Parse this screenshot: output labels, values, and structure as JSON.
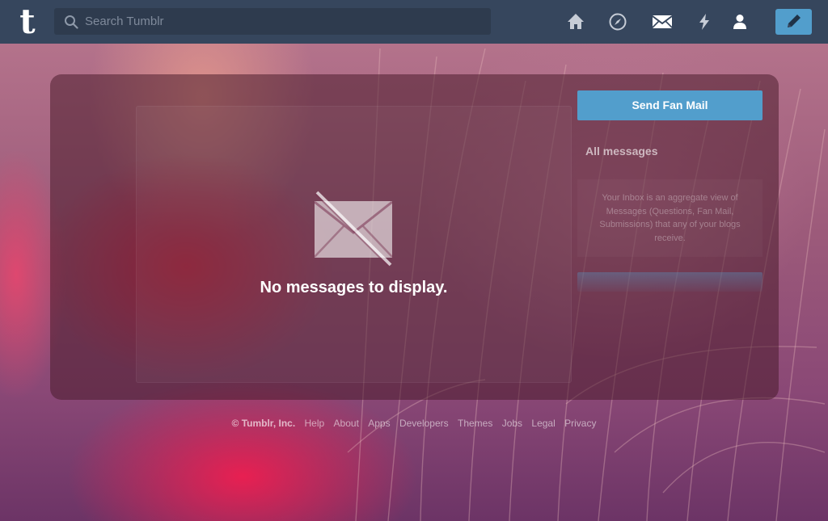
{
  "topbar": {
    "logo": "t",
    "search": {
      "placeholder": "Search Tumblr",
      "value": ""
    },
    "icons": [
      "home-icon",
      "explore-compass-icon",
      "inbox-envelope-icon",
      "activity-lightning-icon",
      "account-person-icon",
      "compose-pencil-icon"
    ]
  },
  "main": {
    "empty_message": "No messages to display."
  },
  "sidebar": {
    "fan_mail_button": "Send Fan Mail",
    "all_messages": "All messages",
    "inbox_info": "Your Inbox is an aggregate view of Messages (Questions, Fan Mail, Submissions) that any of your blogs receive."
  },
  "footer": {
    "copyright": "© Tumblr, Inc.",
    "links": [
      "Help",
      "About",
      "Apps",
      "Developers",
      "Themes",
      "Jobs",
      "Legal",
      "Privacy"
    ]
  },
  "colors": {
    "topbar": "#36465d",
    "search_bg": "#2e3b4e",
    "accent_blue": "#529ecc",
    "panel_overlay": "rgba(70,24,40,0.52)"
  }
}
